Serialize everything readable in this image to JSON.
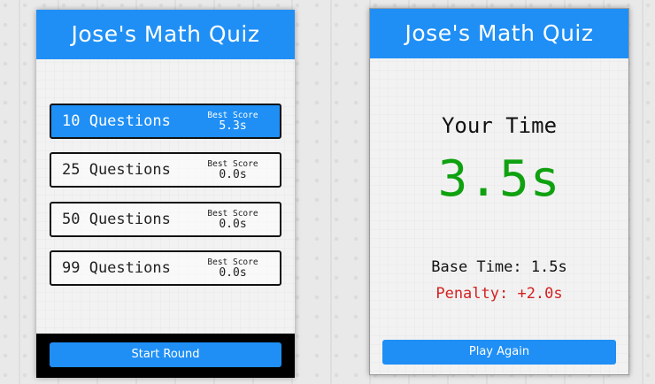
{
  "quiz_title": "Jose's Math Quiz",
  "selection_screen": {
    "options": [
      {
        "label": "10 Questions",
        "best_score_label": "Best Score",
        "best_score": "5.3s",
        "selected": true
      },
      {
        "label": "25 Questions",
        "best_score_label": "Best Score",
        "best_score": "0.0s",
        "selected": false
      },
      {
        "label": "50 Questions",
        "best_score_label": "Best Score",
        "best_score": "0.0s",
        "selected": false
      },
      {
        "label": "99 Questions",
        "best_score_label": "Best Score",
        "best_score": "0.0s",
        "selected": false
      }
    ],
    "start_button": "Start Round"
  },
  "score_screen": {
    "heading": "Your Time",
    "final_time": "3.5s",
    "base_time": "Base Time: 1.5s",
    "penalty": "Penalty: +2.0s",
    "play_again_button": "Play Again"
  },
  "colors": {
    "accent": "#1f8ff5",
    "final_time": "#0fa10f",
    "penalty": "#d32222",
    "footer": "#000000"
  }
}
